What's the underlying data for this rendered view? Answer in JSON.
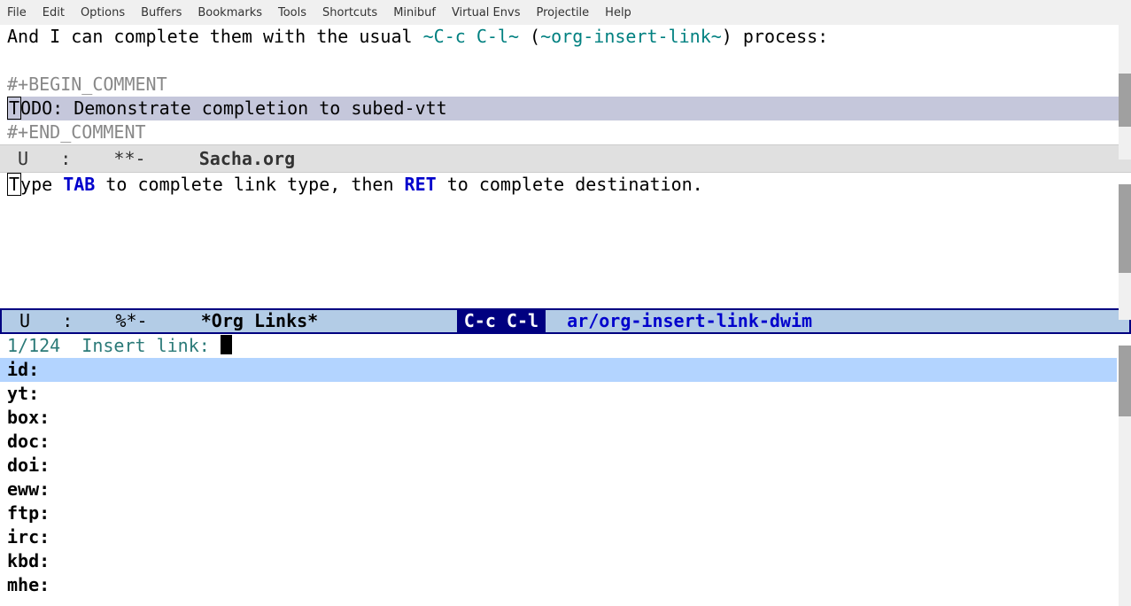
{
  "menu": {
    "items": [
      "File",
      "Edit",
      "Options",
      "Buffers",
      "Bookmarks",
      "Tools",
      "Shortcuts",
      "Minibuf",
      "Virtual Envs",
      "Projectile",
      "Help"
    ]
  },
  "buffer1": {
    "line1_pre": "And I can complete them with the usual ",
    "line1_code1": "~C-c C-l~",
    "line1_mid": " (",
    "line1_code2": "~org-insert-link~",
    "line1_post": ") process:",
    "begin_comment": "#+BEGIN_COMMENT",
    "todo_first_char": "T",
    "todo_rest": "ODO: Demonstrate completion to subed-vtt",
    "end_comment": "#+END_COMMENT"
  },
  "modeline1": {
    "left": " U   :    **-     ",
    "file": "Sacha.org"
  },
  "buffer2": {
    "first_char": "T",
    "part1": "ype ",
    "tab": "TAB",
    "part2": " to complete link type, then ",
    "ret": "RET",
    "part3": " to complete destination."
  },
  "modeline2": {
    "left": " U   :    %*-     ",
    "buf": "*Org Links*",
    "gap": "             ",
    "keybind": "C-c C-l",
    "sep": "  ",
    "cmd": "ar/org-insert-link-dwim"
  },
  "minibuf": {
    "count": "1/124",
    "prompt": "  Insert link: "
  },
  "completions": {
    "items": [
      "id:",
      "yt:",
      "box:",
      "doc:",
      "doi:",
      "eww:",
      "ftp:",
      "irc:",
      "kbd:",
      "mhe:"
    ],
    "selected_index": 0
  }
}
